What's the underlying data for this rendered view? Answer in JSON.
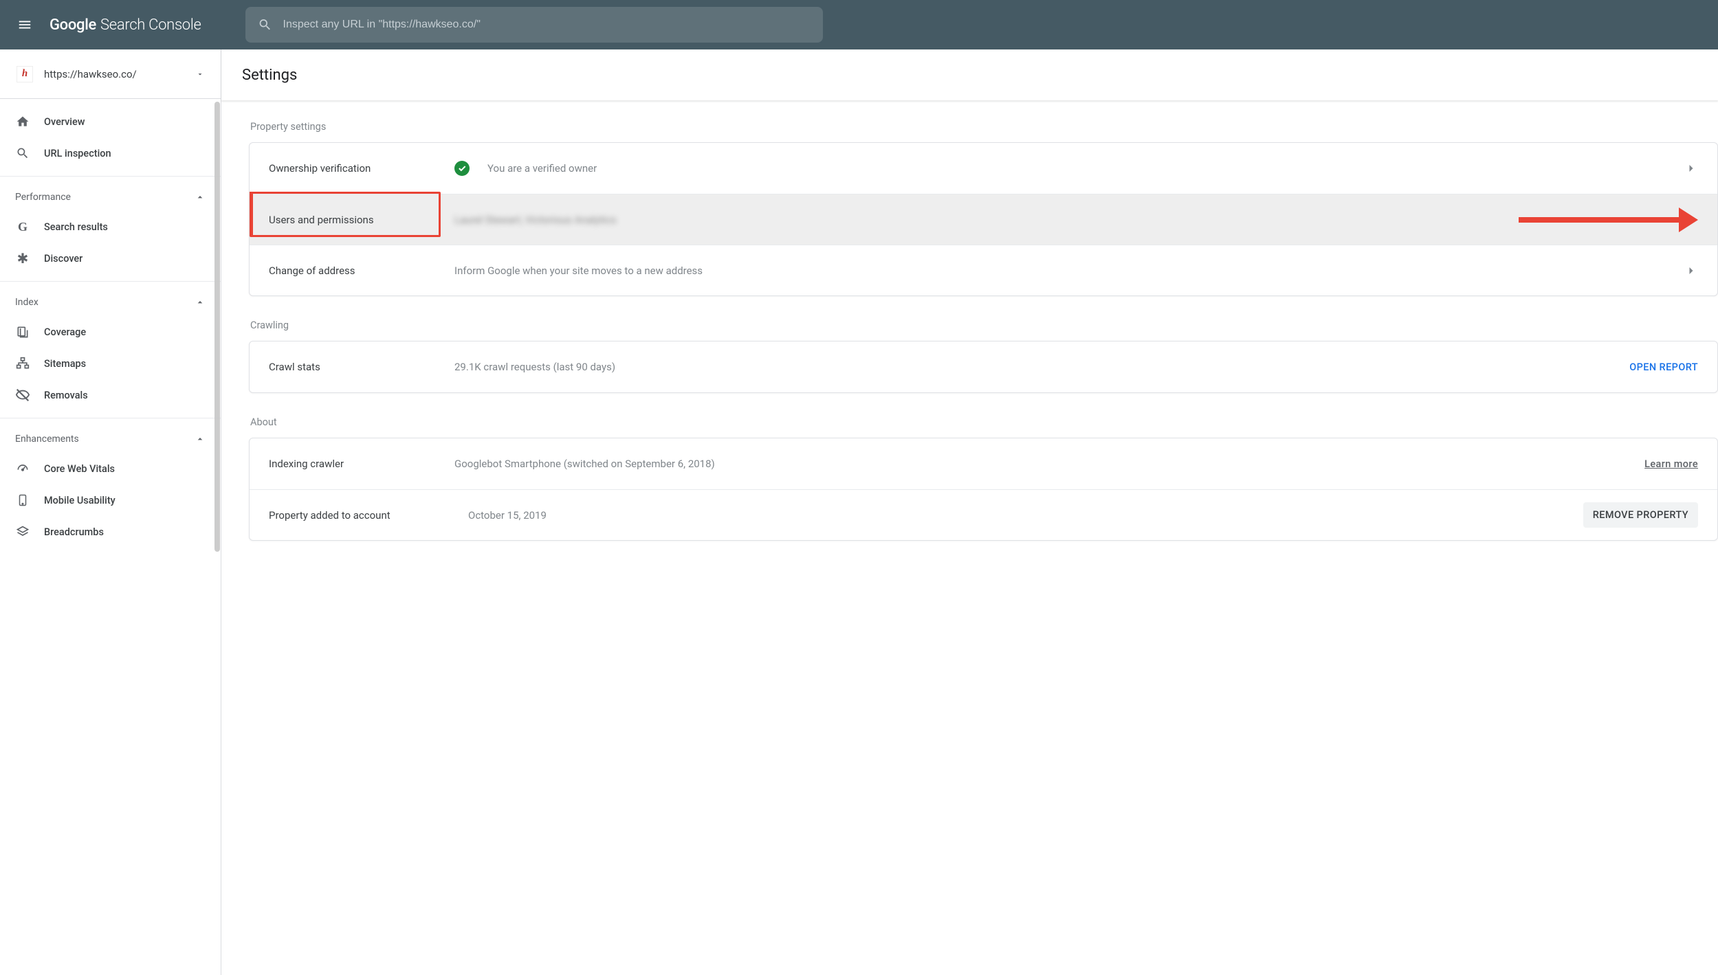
{
  "header": {
    "brand_google": "Google",
    "brand_app": "Search Console",
    "search_placeholder": "Inspect any URL in \"https://hawkseo.co/\""
  },
  "sidebar": {
    "property_url": "https://hawkseo.co/",
    "items_top": [
      {
        "label": "Overview"
      },
      {
        "label": "URL inspection"
      }
    ],
    "section_performance": {
      "label": "Performance",
      "items": [
        {
          "label": "Search results"
        },
        {
          "label": "Discover"
        }
      ]
    },
    "section_index": {
      "label": "Index",
      "items": [
        {
          "label": "Coverage"
        },
        {
          "label": "Sitemaps"
        },
        {
          "label": "Removals"
        }
      ]
    },
    "section_enhancements": {
      "label": "Enhancements",
      "items": [
        {
          "label": "Core Web Vitals"
        },
        {
          "label": "Mobile Usability"
        },
        {
          "label": "Breadcrumbs"
        }
      ]
    }
  },
  "page": {
    "title": "Settings",
    "sections": {
      "property_settings": {
        "label": "Property settings",
        "ownership": {
          "label": "Ownership verification",
          "value": "You are a verified owner"
        },
        "users": {
          "label": "Users and permissions",
          "value": "Laurel Stewart, Victorious Analytics"
        },
        "change_address": {
          "label": "Change of address",
          "value": "Inform Google when your site moves to a new address"
        }
      },
      "crawling": {
        "label": "Crawling",
        "crawl_stats": {
          "label": "Crawl stats",
          "value": "29.1K crawl requests (last 90 days)",
          "action": "OPEN REPORT"
        }
      },
      "about": {
        "label": "About",
        "indexing": {
          "label": "Indexing crawler",
          "value": "Googlebot Smartphone (switched on September 6, 2018)",
          "action": "Learn more"
        },
        "added": {
          "label": "Property added to account",
          "value": "October 15, 2019",
          "action": "REMOVE PROPERTY"
        }
      }
    }
  }
}
